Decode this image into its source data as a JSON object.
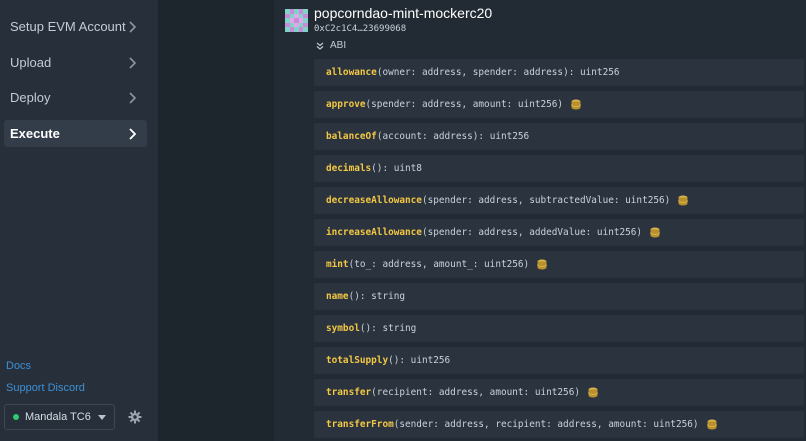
{
  "sidebar": {
    "items": [
      {
        "label": "Setup EVM Account"
      },
      {
        "label": "Upload"
      },
      {
        "label": "Deploy"
      },
      {
        "label": "Execute"
      }
    ],
    "links": [
      {
        "label": "Docs"
      },
      {
        "label": "Support Discord"
      }
    ],
    "network": {
      "label": "Mandala TC6"
    }
  },
  "contract": {
    "name": "popcorndao-mint-mockerc20",
    "address": "0xC2c1C4…23699068",
    "abi_label": "ABI"
  },
  "functions": [
    {
      "name": "allowance",
      "sig": "(owner: address, spender: address): uint256"
    },
    {
      "name": "approve",
      "sig": "(spender: address, amount: uint256)"
    },
    {
      "name": "balanceOf",
      "sig": "(account: address): uint256"
    },
    {
      "name": "decimals",
      "sig": "(): uint8"
    },
    {
      "name": "decreaseAllowance",
      "sig": "(spender: address, subtractedValue: uint256)"
    },
    {
      "name": "increaseAllowance",
      "sig": "(spender: address, addedValue: uint256)"
    },
    {
      "name": "mint",
      "sig": "(to_: address, amount_: uint256)"
    },
    {
      "name": "name",
      "sig": "(): string"
    },
    {
      "name": "symbol",
      "sig": "(): string"
    },
    {
      "name": "totalSupply",
      "sig": "(): uint256"
    },
    {
      "name": "transfer",
      "sig": "(recipient: address, amount: uint256)"
    },
    {
      "name": "transferFrom",
      "sig": "(sender: address, recipient: address, amount: uint256)"
    }
  ],
  "colors": {
    "accent": "#f2c744",
    "link": "#3d8fd6",
    "status": "#2ecc71"
  }
}
